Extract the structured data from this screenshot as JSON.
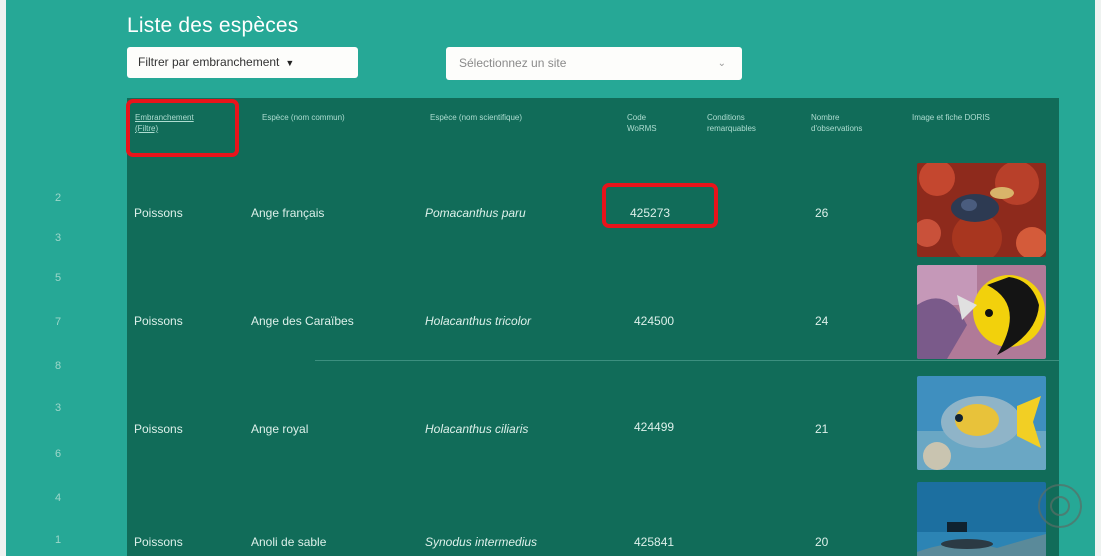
{
  "page": {
    "title": "Liste des espèces"
  },
  "filters": {
    "embranchement_label": "Filtrer par embranchement",
    "site_placeholder": "Sélectionnez un site"
  },
  "table": {
    "headers": [
      {
        "line1": "Embranchement",
        "line2": "(Filtre)"
      },
      {
        "line1": "Espèce (nom commun)",
        "line2": ""
      },
      {
        "line1": "Espèce (nom scientifique)",
        "line2": ""
      },
      {
        "line1": "Code",
        "line2": "WoRMS"
      },
      {
        "line1": "Conditions",
        "line2": "remarquables"
      },
      {
        "line1": "Nombre",
        "line2": "d'observations"
      },
      {
        "line1": "Image et fiche DORIS",
        "line2": ""
      }
    ],
    "rows": [
      {
        "embranchement": "Poissons",
        "common": "Ange français",
        "scientific": "Pomacanthus paru",
        "code": "425273",
        "observations": "26",
        "image": "coral-red-fish"
      },
      {
        "embranchement": "Poissons",
        "common": "Ange des Caraïbes",
        "scientific": "Holacanthus tricolor",
        "code": "424500",
        "observations": "24",
        "image": "yellow-black-angelfish"
      },
      {
        "embranchement": "Poissons",
        "common": "Ange royal",
        "scientific": "Holacanthus ciliaris",
        "code": "424499",
        "observations": "21",
        "image": "blue-yellow-angelfish"
      },
      {
        "embranchement": "Poissons",
        "common": "Anoli de sable",
        "scientific": "Synodus intermedius",
        "code": "425841",
        "observations": "20",
        "image": "lizardfish-sand"
      }
    ]
  },
  "rail": [
    "2",
    "3",
    "5",
    "7",
    "8",
    "3",
    "6",
    "4",
    "1"
  ],
  "colors": {
    "background": "#26a896",
    "table": "#116c59",
    "highlight": "#e8141b"
  }
}
